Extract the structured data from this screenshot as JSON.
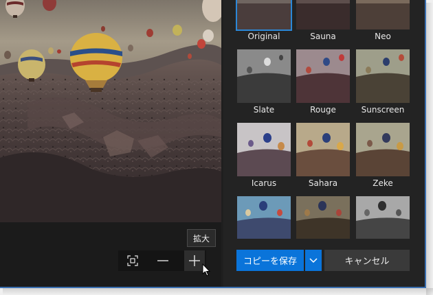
{
  "filters": [
    {
      "label": "Original",
      "selected": true
    },
    {
      "label": "Sauna"
    },
    {
      "label": "Neo"
    },
    {
      "label": "Slate"
    },
    {
      "label": "Rouge"
    },
    {
      "label": "Sunscreen"
    },
    {
      "label": "Icarus"
    },
    {
      "label": "Sahara"
    },
    {
      "label": "Zeke"
    },
    {
      "label": ""
    },
    {
      "label": ""
    },
    {
      "label": ""
    }
  ],
  "zoom": {
    "fit_icon": "fit-to-window-icon",
    "minus_icon": "zoom-out-icon",
    "plus_icon": "zoom-in-icon",
    "tooltip": "拡大"
  },
  "actions": {
    "save_label": "コピーを保存",
    "cancel_label": "キャンセル",
    "dropdown_icon": "chevron-down-icon"
  },
  "colors": {
    "accent": "#0a74da",
    "panel_bg": "#232323",
    "app_bg": "#1f1f1f"
  }
}
